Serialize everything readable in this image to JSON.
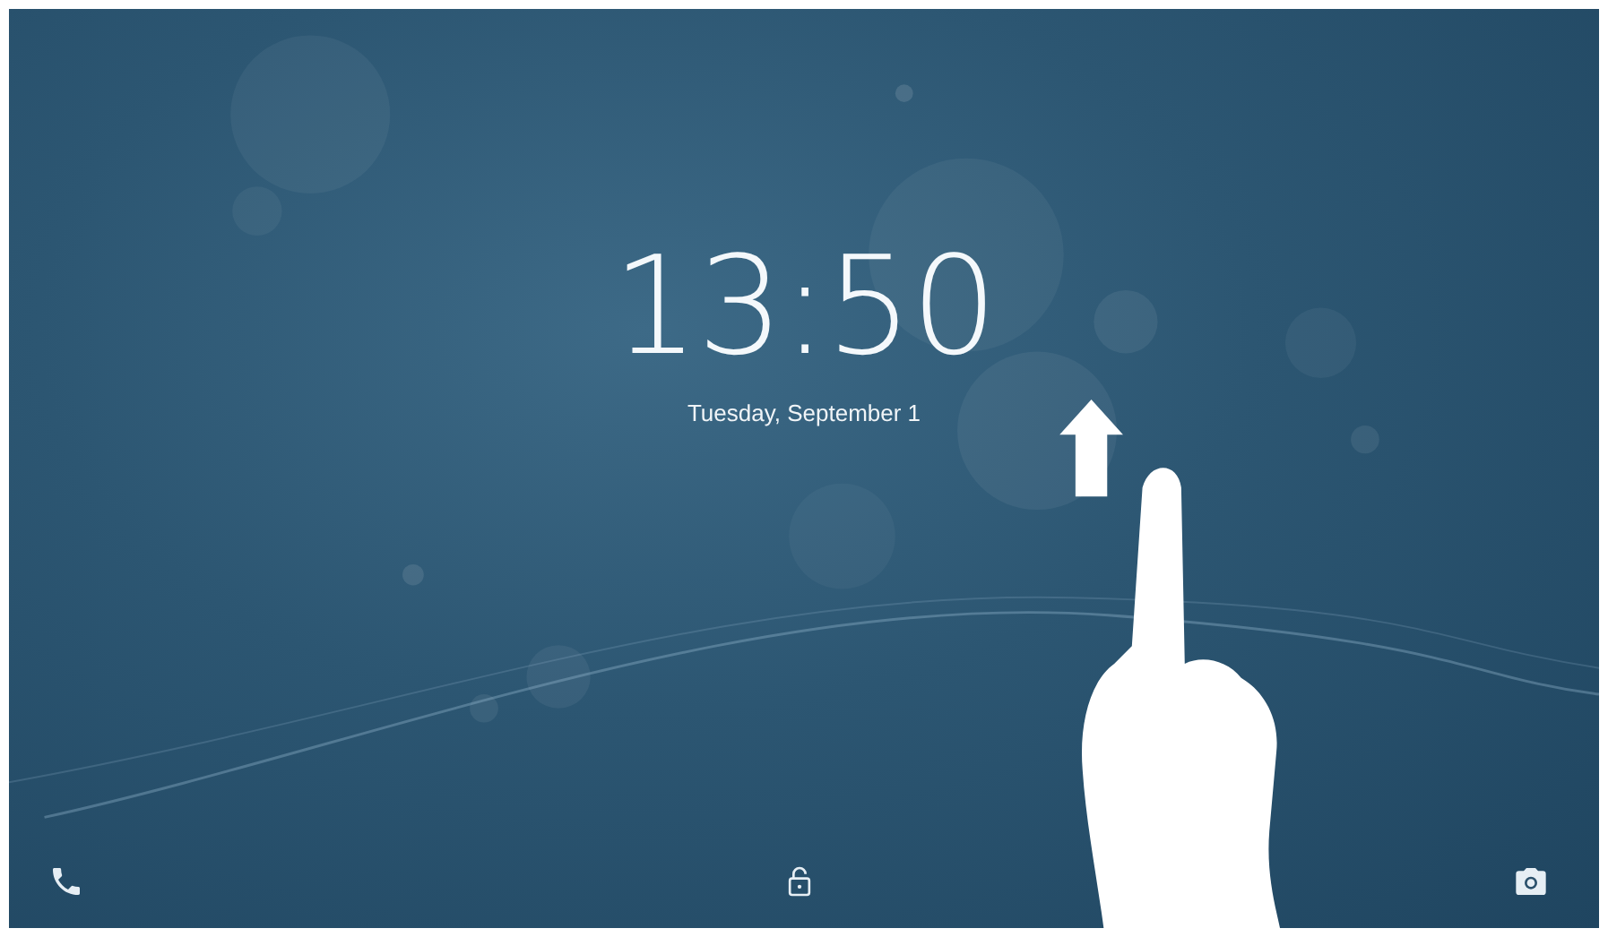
{
  "lock_screen": {
    "clock": "13:50",
    "date": "Tuesday, September 1"
  },
  "bottom_bar": {
    "shortcuts": [
      {
        "kind": "phone"
      },
      {
        "kind": "lock"
      },
      {
        "kind": "camera"
      }
    ]
  }
}
